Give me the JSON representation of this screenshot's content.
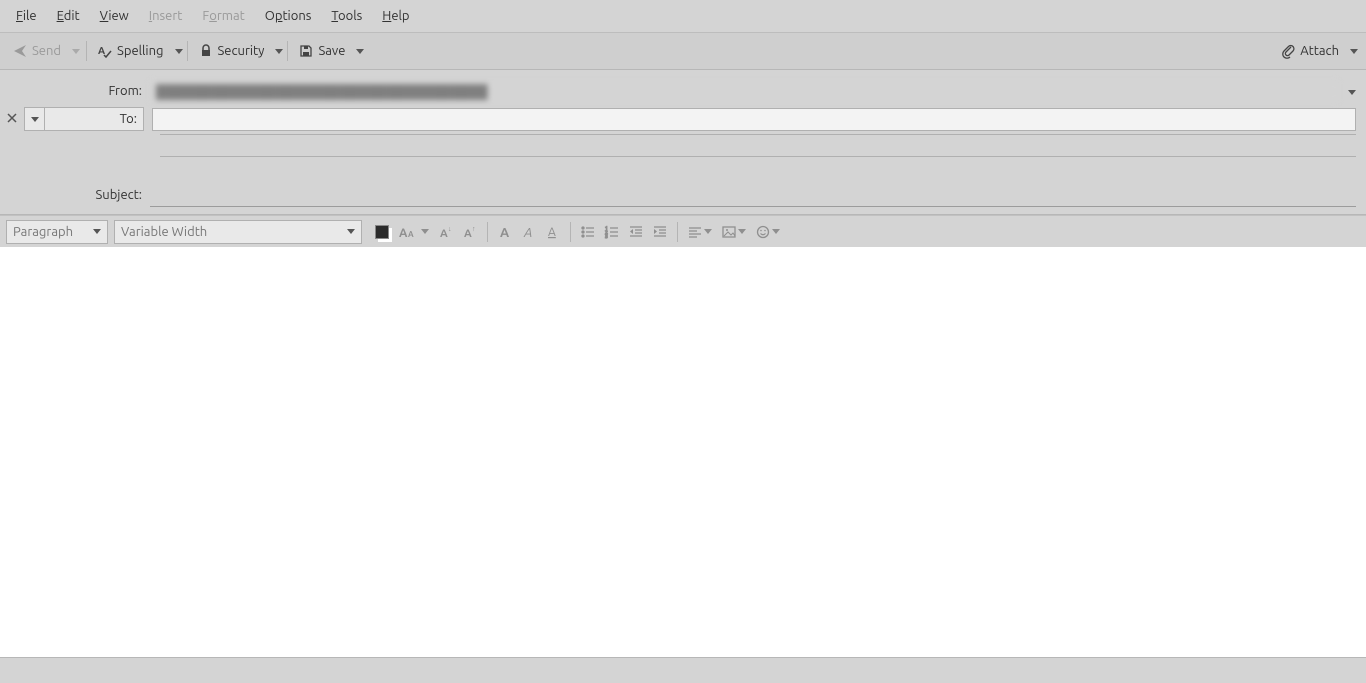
{
  "menubar": {
    "file": "File",
    "edit": "Edit",
    "view": "View",
    "insert": "Insert",
    "format": "Format",
    "options": "Options",
    "tools": "Tools",
    "help": "Help"
  },
  "toolbar": {
    "send": "Send",
    "spelling": "Spelling",
    "security": "Security",
    "save": "Save",
    "attach": "Attach"
  },
  "header": {
    "from_label": "From:",
    "from_value": "████████████████████████████████████",
    "to_label": "To:",
    "to_value": "",
    "subject_label": "Subject:",
    "subject_value": ""
  },
  "format": {
    "paragraph": "Paragraph",
    "font": "Variable Width"
  }
}
